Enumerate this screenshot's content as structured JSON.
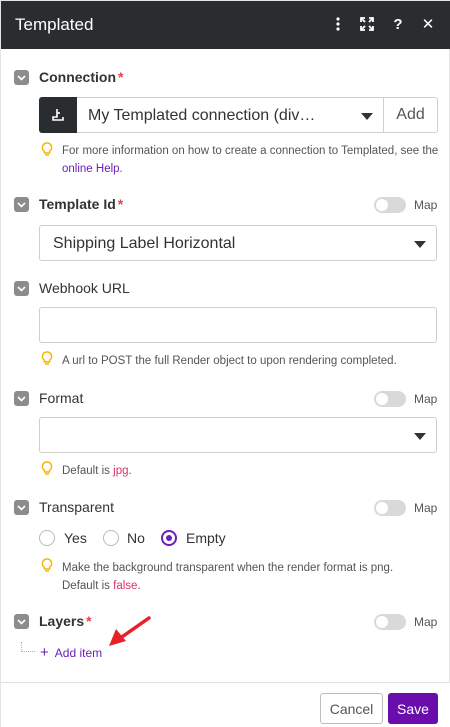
{
  "header": {
    "title": "Templated"
  },
  "connection": {
    "label": "Connection",
    "required_mark": "*",
    "selected": "My Templated connection (div…",
    "add_label": "Add",
    "hint_pre": "For more information on how to create a connection to Templated, see the",
    "hint_link": "online Help",
    "hint_post": "."
  },
  "template_id": {
    "label": "Template Id",
    "required_mark": "*",
    "map_label": "Map",
    "selected": "Shipping Label Horizontal"
  },
  "webhook": {
    "label": "Webhook URL",
    "value": "",
    "hint": "A url to POST the full Render object to upon rendering completed."
  },
  "format": {
    "label": "Format",
    "map_label": "Map",
    "selected": "",
    "hint_pre": "Default is",
    "hint_code": "jpg",
    "hint_post": "."
  },
  "transparent": {
    "label": "Transparent",
    "map_label": "Map",
    "options": [
      "Yes",
      "No",
      "Empty"
    ],
    "selected": "Empty",
    "hint_line1": "Make the background transparent when the render format is png.",
    "hint_pre": "Default is",
    "hint_code": "false",
    "hint_post": "."
  },
  "layers": {
    "label": "Layers",
    "required_mark": "*",
    "map_label": "Map",
    "add_item": "Add item"
  },
  "footer": {
    "cancel": "Cancel",
    "save": "Save"
  },
  "colors": {
    "accent": "#6a0dad",
    "header_bg": "#2a2d30",
    "required": "#e3414b",
    "annotation_arrow": "#e8202a"
  }
}
